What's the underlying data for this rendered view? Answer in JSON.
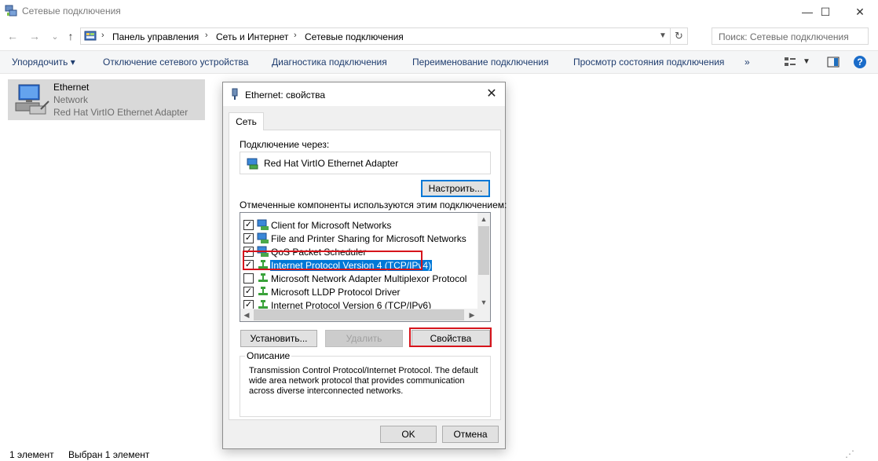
{
  "window": {
    "title": "Сетевые подключения",
    "minimize_glyph": "—",
    "maximize_glyph": "☐",
    "close_glyph": "✕"
  },
  "nav": {
    "back_glyph": "←",
    "forward_glyph": "→",
    "recent_glyph": "⌄",
    "up_glyph": "↑",
    "breadcrumb": [
      "Панель управления",
      "Сеть и Интернет",
      "Сетевые подключения"
    ],
    "breadcrumb_sep": "›",
    "search_placeholder": "Поиск: Сетевые подключения"
  },
  "commandbar": {
    "organize": "Упорядочить ▾",
    "disable": "Отключение сетевого устройства",
    "diagnose": "Диагностика подключения",
    "rename": "Переименование подключения",
    "status": "Просмотр состояния подключения",
    "more": "»"
  },
  "connection": {
    "name": "Ethernet",
    "network": "Network",
    "adapter": "Red Hat VirtIO Ethernet Adapter"
  },
  "statusbar": {
    "count": "1 элемент",
    "selected": "Выбран 1 элемент"
  },
  "dialog": {
    "title": "Ethernet: свойства",
    "tab": "Сеть",
    "connect_using_label": "Подключение через:",
    "adapter_name": "Red Hat VirtIO Ethernet Adapter",
    "configure_button": "Настроить...",
    "components_label": "Отмеченные компоненты используются этим подключением:",
    "components": [
      {
        "label": "Client for Microsoft Networks",
        "checked": true,
        "icon": "network-client-icon"
      },
      {
        "label": "File and Printer Sharing for Microsoft Networks",
        "checked": true,
        "icon": "network-service-icon"
      },
      {
        "label": "QoS Packet Scheduler",
        "checked": true,
        "icon": "network-service-icon"
      },
      {
        "label": "Internet Protocol Version 4 (TCP/IPv4)",
        "checked": true,
        "icon": "network-protocol-icon",
        "selected": true
      },
      {
        "label": "Microsoft Network Adapter Multiplexor Protocol",
        "checked": false,
        "icon": "network-protocol-icon"
      },
      {
        "label": "Microsoft LLDP Protocol Driver",
        "checked": true,
        "icon": "network-protocol-icon"
      },
      {
        "label": "Internet Protocol Version 6 (TCP/IPv6)",
        "checked": true,
        "icon": "network-protocol-icon"
      }
    ],
    "install_button": "Установить...",
    "uninstall_button": "Удалить",
    "properties_button": "Свойства",
    "description_legend": "Описание",
    "description_text": "Transmission Control Protocol/Internet Protocol. The default wide area network protocol that provides communication across diverse interconnected networks.",
    "ok_button": "OK",
    "cancel_button": "Отмена"
  },
  "colors": {
    "highlight": "#d6141c",
    "selection": "#0078d7",
    "command_text": "#1e3c6e"
  }
}
